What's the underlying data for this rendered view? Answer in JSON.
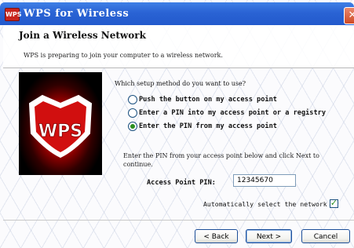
{
  "window": {
    "title": "WPS for Wireless",
    "app_icon_text": "WPS",
    "close_symbol": "✕"
  },
  "header": {
    "title": "Join a Wireless Network",
    "description": "WPS is preparing to join your computer to a wireless network."
  },
  "logo": {
    "text": "WPS"
  },
  "setup": {
    "question": "Which setup method do you want to use?",
    "options": [
      {
        "label": "Push the button on my access point",
        "checked": false
      },
      {
        "label": "Enter a PIN into my access point or a registry",
        "checked": false
      },
      {
        "label": "Enter the PIN from my access point",
        "checked": true
      }
    ]
  },
  "pin": {
    "instructions": "Enter the PIN from your access point below and click Next to continue.",
    "label": "Access Point PIN:",
    "value": "12345670"
  },
  "auto_select": {
    "label": "Automatically select the network",
    "checked": true
  },
  "buttons": {
    "back": "< Back",
    "next": "Next >",
    "cancel": "Cancel"
  }
}
